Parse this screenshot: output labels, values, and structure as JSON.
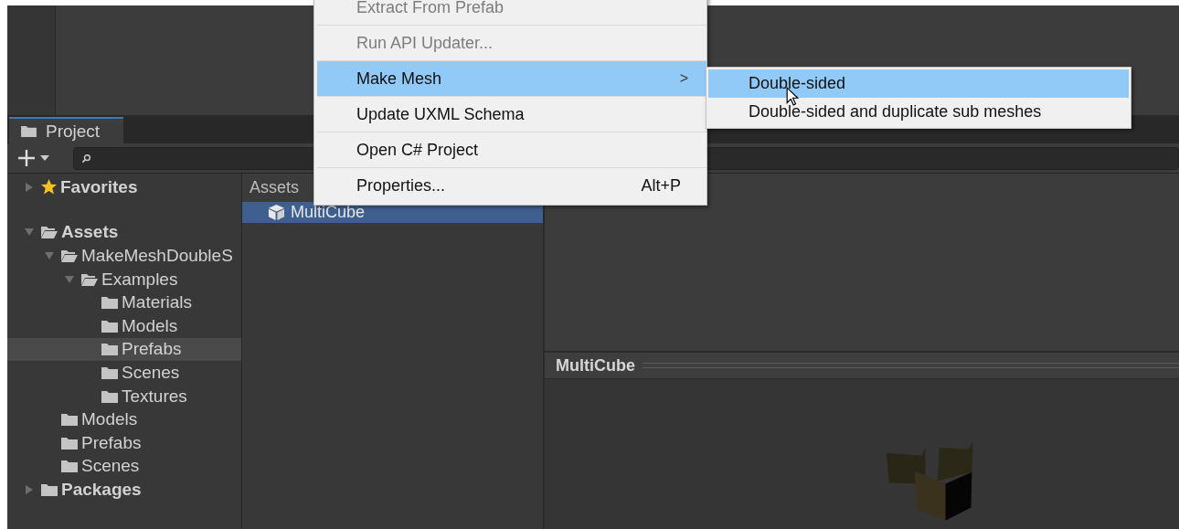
{
  "project_panel": {
    "tab": {
      "label": "Project",
      "selected": true
    },
    "tree": [
      {
        "label": "Favorites",
        "kind": "favorites",
        "expanded": false,
        "selected": false
      },
      {
        "label": "Assets",
        "kind": "folder",
        "expanded": true,
        "selected": false,
        "children": [
          {
            "label": "MakeMeshDoubleS",
            "kind": "folder",
            "expanded": true,
            "selected": false,
            "children": [
              {
                "label": "Examples",
                "kind": "folder",
                "expanded": true,
                "selected": false,
                "children": [
                  {
                    "label": "Materials",
                    "kind": "folder",
                    "selected": false
                  },
                  {
                    "label": "Models",
                    "kind": "folder",
                    "selected": false
                  },
                  {
                    "label": "Prefabs",
                    "kind": "folder",
                    "selected": true
                  },
                  {
                    "label": "Scenes",
                    "kind": "folder",
                    "selected": false
                  },
                  {
                    "label": "Textures",
                    "kind": "folder",
                    "selected": false
                  }
                ]
              }
            ]
          },
          {
            "label": "Models",
            "kind": "folder",
            "selected": false
          },
          {
            "label": "Prefabs",
            "kind": "folder",
            "selected": false
          },
          {
            "label": "Scenes",
            "kind": "folder",
            "selected": false
          }
        ]
      },
      {
        "label": "Packages",
        "kind": "folder",
        "expanded": false,
        "selected": false
      }
    ],
    "breadcrumb": "Assets",
    "assets": [
      {
        "label": "MultiCube",
        "selected": true
      }
    ]
  },
  "preview": {
    "title": "MultiCube"
  },
  "context_menu": {
    "items": [
      {
        "label": "Extract From Prefab",
        "disabled": true,
        "selected": false
      },
      {
        "label": "Run API Updater...",
        "disabled": true,
        "selected": false
      },
      {
        "label": "Make Mesh",
        "disabled": false,
        "selected": true,
        "submenu_arrow": ">"
      },
      {
        "label": "Update UXML Schema",
        "disabled": false,
        "selected": false
      },
      {
        "label": "Open C# Project",
        "disabled": false,
        "selected": false
      },
      {
        "label": "Properties...",
        "disabled": false,
        "selected": false,
        "shortcut": "Alt+P"
      }
    ]
  },
  "submenu": {
    "items": [
      {
        "label": "Double-sided",
        "selected": true
      },
      {
        "label": "Double-sided and duplicate sub meshes",
        "selected": false
      }
    ]
  }
}
